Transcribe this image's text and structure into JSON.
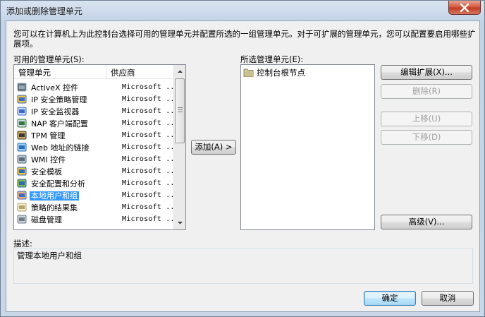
{
  "window": {
    "title": "添加或删除管理单元",
    "close_icon": "close-icon"
  },
  "intro_text": "您可以在计算机上为此控制台选择可用的管理单元并配置所选的一组管理单元。对于可扩展的管理单元，您可以配置要启用哪些扩展项。",
  "available": {
    "label": "可用的管理单元(S):",
    "columns": [
      "管理单元",
      "供应商"
    ],
    "items": [
      {
        "name": "ActiveX 控件",
        "vendor": "Microsoft ...",
        "icon": "activex-icon"
      },
      {
        "name": "IP 安全策略管理",
        "vendor": "Microsoft ...",
        "icon": "ip-security-policy-icon"
      },
      {
        "name": "IP 安全监视器",
        "vendor": "Microsoft ...",
        "icon": "ip-security-monitor-icon"
      },
      {
        "name": "NAP 客户端配置",
        "vendor": "Microsoft ...",
        "icon": "nap-client-icon"
      },
      {
        "name": "TPM 管理",
        "vendor": "Microsoft ...",
        "icon": "tpm-icon"
      },
      {
        "name": "Web 地址的链接",
        "vendor": "Microsoft ...",
        "icon": "web-link-icon"
      },
      {
        "name": "WMI 控件",
        "vendor": "Microsoft ...",
        "icon": "wmi-icon"
      },
      {
        "name": "安全模板",
        "vendor": "Microsoft ...",
        "icon": "security-template-icon"
      },
      {
        "name": "安全配置和分析",
        "vendor": "Microsoft ...",
        "icon": "security-config-icon"
      },
      {
        "name": "本地用户和组",
        "vendor": "Microsoft ...",
        "icon": "users-groups-icon",
        "selected": true
      },
      {
        "name": "策略的结果集",
        "vendor": "Microsoft ...",
        "icon": "rsop-icon"
      },
      {
        "name": "磁盘管理",
        "vendor": "Microsoft ...",
        "icon": "disk-management-icon"
      }
    ]
  },
  "add_button": "添加(A) >",
  "selected_panel": {
    "label": "所选管理单元(E):",
    "root_node": "控制台根节点",
    "root_icon": "folder-icon"
  },
  "side_buttons": {
    "edit_extensions": "编辑扩展(X)...",
    "remove": "删除(R)",
    "move_up": "上移(U)",
    "move_down": "下移(D)",
    "advanced": "高级(V)..."
  },
  "description": {
    "label": "描述:",
    "text": "管理本地用户和组"
  },
  "footer": {
    "ok": "确定",
    "cancel": "取消"
  }
}
